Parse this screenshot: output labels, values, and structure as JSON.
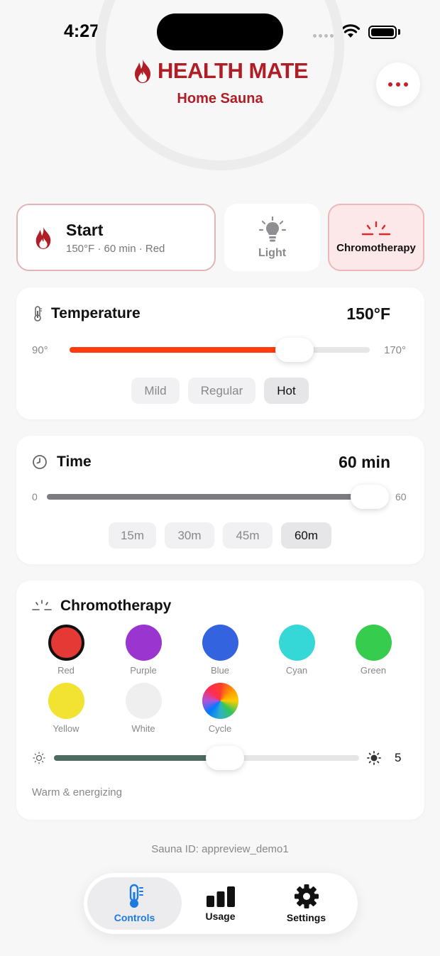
{
  "status_bar": {
    "time": "4:27"
  },
  "header": {
    "brand": "HEALTH MATE",
    "subtitle": "Home Sauna",
    "brand_color": "#b11d24"
  },
  "actions": {
    "start": {
      "label": "Start",
      "summary": "150°F · 60 min · Red"
    },
    "light": {
      "label": "Light"
    },
    "chromotherapy": {
      "label": "Chromotherapy"
    }
  },
  "temperature": {
    "title": "Temperature",
    "value": "150°F",
    "min_label": "90°",
    "max_label": "170°",
    "level": 0.75,
    "accent": "#ff3b0f",
    "presets": [
      {
        "label": "Mild",
        "selected": false
      },
      {
        "label": "Regular",
        "selected": false
      },
      {
        "label": "Hot",
        "selected": true
      }
    ]
  },
  "time": {
    "title": "Time",
    "value": "60 min",
    "min_label": "0",
    "max_label": "60",
    "level": 1.0,
    "presets": [
      {
        "label": "15m",
        "selected": false
      },
      {
        "label": "30m",
        "selected": false
      },
      {
        "label": "45m",
        "selected": false
      },
      {
        "label": "60m",
        "selected": true
      }
    ]
  },
  "chromotherapy": {
    "title": "Chromotherapy",
    "colors": [
      {
        "label": "Red",
        "hex": "#e53935",
        "selected": true
      },
      {
        "label": "Purple",
        "hex": "#9b35cf",
        "selected": false
      },
      {
        "label": "Blue",
        "hex": "#3463e0",
        "selected": false
      },
      {
        "label": "Cyan",
        "hex": "#35d7d7",
        "selected": false
      },
      {
        "label": "Green",
        "hex": "#36cc4e",
        "selected": false
      },
      {
        "label": "Yellow",
        "hex": "#f2e232",
        "selected": false
      },
      {
        "label": "White",
        "hex": "#efefef",
        "selected": false
      },
      {
        "label": "Cycle",
        "hex": "rainbow",
        "selected": false
      }
    ],
    "brightness_value": "5",
    "brightness_level": 0.56,
    "description": "Warm & energizing"
  },
  "footer": {
    "sauna_id": "Sauna ID: appreview_demo1"
  },
  "tabs": [
    {
      "label": "Controls",
      "icon": "thermometer-icon",
      "active": true
    },
    {
      "label": "Usage",
      "icon": "bar-chart-icon",
      "active": false
    },
    {
      "label": "Settings",
      "icon": "gear-icon",
      "active": false
    }
  ]
}
